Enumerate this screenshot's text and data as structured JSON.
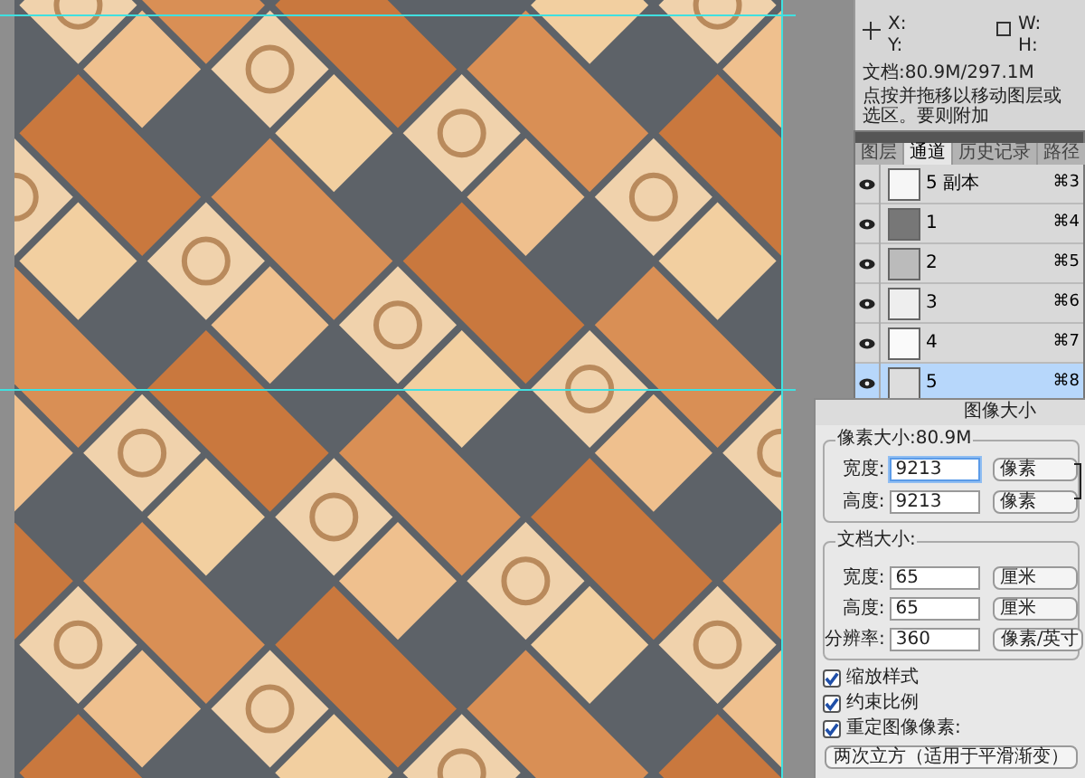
{
  "info_panel": {
    "x_label": "X:",
    "y_label": "Y:",
    "w_label": "W:",
    "h_label": "H:",
    "doc_size": "文档:80.9M/297.1M",
    "hint": "点按并拖移以移动图层或选区。要则附加"
  },
  "channels_panel": {
    "tabs": [
      {
        "label": "图层",
        "selected": false
      },
      {
        "label": "通道",
        "selected": true
      },
      {
        "label": "历史记录",
        "selected": false
      },
      {
        "label": "路径",
        "selected": false
      }
    ],
    "rows": [
      {
        "name": "5 副本",
        "shortcut": "⌘3",
        "visible": true,
        "selected": false
      },
      {
        "name": "1",
        "shortcut": "⌘4",
        "visible": true,
        "selected": false
      },
      {
        "name": "2",
        "shortcut": "⌘5",
        "visible": true,
        "selected": false
      },
      {
        "name": "3",
        "shortcut": "⌘6",
        "visible": true,
        "selected": false
      },
      {
        "name": "4",
        "shortcut": "⌘7",
        "visible": true,
        "selected": false
      },
      {
        "name": "5",
        "shortcut": "⌘8",
        "visible": true,
        "selected": true
      }
    ]
  },
  "image_size_dialog": {
    "title": "图像大小",
    "pixel_group": {
      "legend": "像素大小:80.9M",
      "fields": [
        {
          "label": "宽度:",
          "value": "9213",
          "unit": "像素",
          "focused": true
        },
        {
          "label": "高度:",
          "value": "9213",
          "unit": "像素",
          "focused": false
        }
      ]
    },
    "document_group": {
      "legend": "文档大小:",
      "fields": [
        {
          "label": "宽度:",
          "value": "65",
          "unit": "厘米",
          "focused": false
        },
        {
          "label": "高度:",
          "value": "65",
          "unit": "厘米",
          "focused": false
        },
        {
          "label": "分辨率:",
          "value": "360",
          "unit": "像素/英寸",
          "focused": false
        }
      ]
    },
    "options": [
      {
        "label": "缩放样式",
        "checked": true
      },
      {
        "label": "约束比例",
        "checked": true
      },
      {
        "label": "重定图像像素:",
        "checked": true
      }
    ],
    "resample_method": "两次立方（适用于平滑渐变）"
  }
}
